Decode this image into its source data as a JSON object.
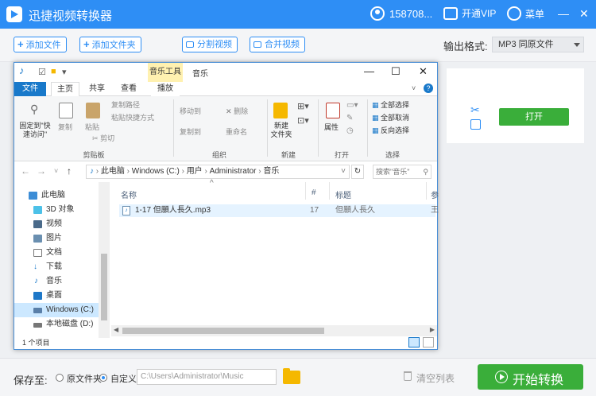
{
  "app": {
    "title": "迅捷视频转换器",
    "user": "158708...",
    "vip": "开通VIP",
    "menu": "菜单"
  },
  "toolbar": {
    "add_file": "添加文件",
    "add_folder": "添加文件夹",
    "split_video": "分割视频",
    "merge_video": "合并视频",
    "format_label": "输出格式:",
    "format_value": "MP3  同原文件"
  },
  "filecard": {
    "open": "打开"
  },
  "bottom": {
    "save_to": "保存至:",
    "opt_original": "原文件夹",
    "opt_custom": "自定义",
    "path": "C:\\Users\\Administrator\\Music",
    "clear": "清空列表",
    "start": "开始转换"
  },
  "explorer": {
    "context_tab": "音乐工具",
    "window_title": "音乐",
    "tabs": [
      "文件",
      "主页",
      "共享",
      "查看",
      "播放"
    ],
    "clipboard": {
      "pin": "固定到\"快速访问\"",
      "copy": "复制",
      "paste": "粘贴",
      "copy_path": "复制路径",
      "paste_shortcut": "粘贴快捷方式",
      "cut": "剪切",
      "section": "剪贴板"
    },
    "organize": {
      "move_to": "移动到",
      "copy_to": "复制到",
      "delete": "删除",
      "rename": "重命名",
      "section": "组织"
    },
    "new": {
      "new_folder": "新建\n文件夹",
      "section": "新建"
    },
    "open": {
      "properties": "属性",
      "section": "打开"
    },
    "select": {
      "select_all": "全部选择",
      "select_none": "全部取消",
      "invert": "反向选择",
      "section": "选择"
    },
    "breadcrumb": [
      "此电脑",
      "Windows (C:)",
      "用户",
      "Administrator",
      "音乐"
    ],
    "search_placeholder": "搜索\"音乐\"",
    "nav": [
      "此电脑",
      "3D 对象",
      "视频",
      "图片",
      "文档",
      "下载",
      "音乐",
      "桌面",
      "Windows (C:)",
      "本地磁盘 (D:)"
    ],
    "columns": [
      "名称",
      "#",
      "标题",
      "参"
    ],
    "files": [
      {
        "name": "1-17 但願人長久.mp3",
        "num": "17",
        "title": "但願人長久",
        "extra": "王"
      }
    ],
    "status": "1 个项目"
  }
}
